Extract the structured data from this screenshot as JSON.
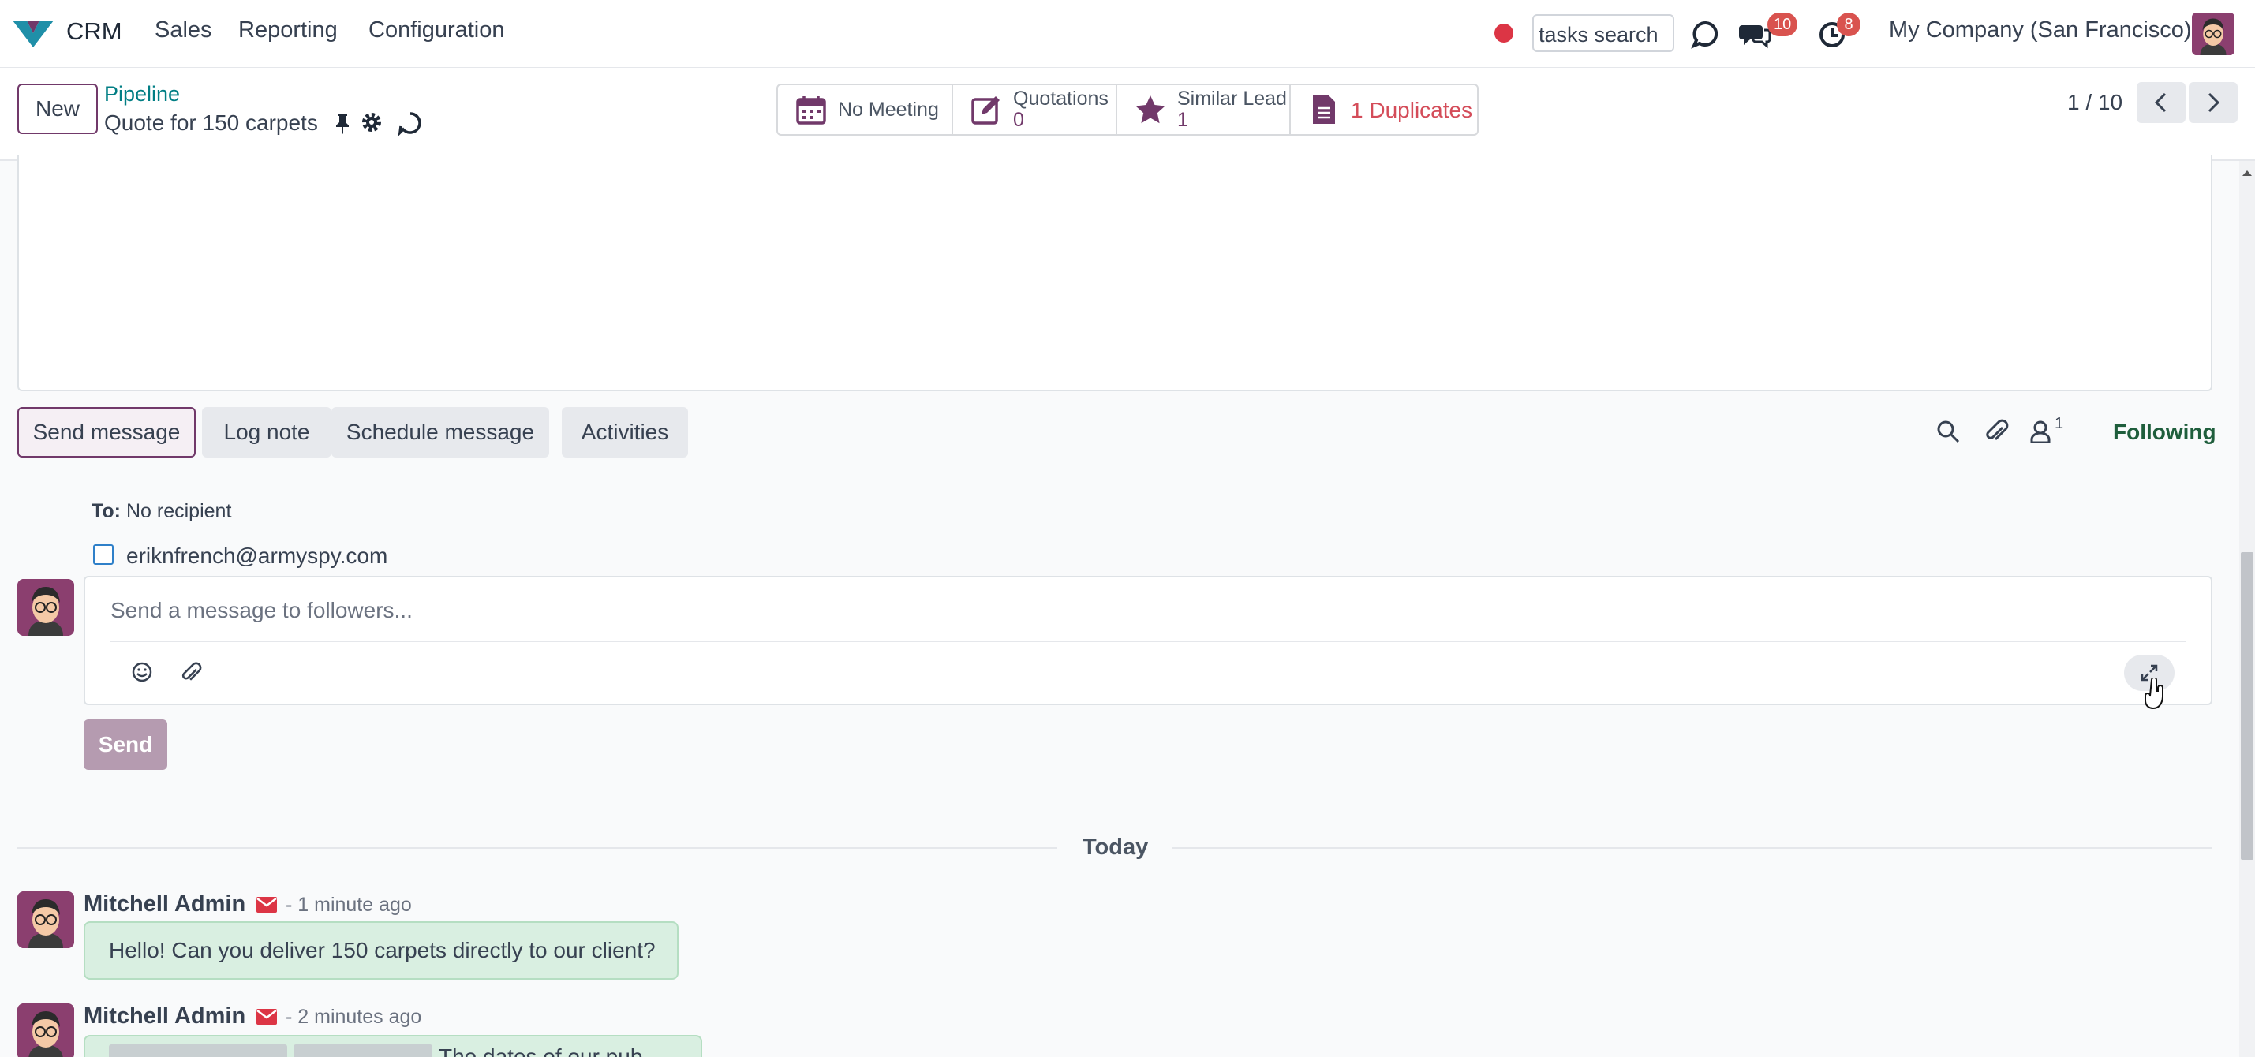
{
  "navbar": {
    "app_name": "CRM",
    "menu": [
      "Sales",
      "Reporting",
      "Configuration"
    ],
    "search_value": "tasks search",
    "messages_count": "10",
    "activities_count": "8",
    "company": "My Company (San Francisco)",
    "accent_color": "#71396a"
  },
  "control_panel": {
    "new_label": "New",
    "breadcrumb_parent": "Pipeline",
    "record_title": "Quote for 150 carpets",
    "pager": "1 / 10"
  },
  "smart_buttons": {
    "meeting": {
      "label": "No Meeting"
    },
    "quotations": {
      "label": "Quotations",
      "count": "0"
    },
    "similar": {
      "label": "Similar Lead",
      "count": "1"
    },
    "duplicates": {
      "label": "1 Duplicates"
    }
  },
  "chatter": {
    "tabs": [
      "Send message",
      "Log note",
      "Schedule message",
      "Activities"
    ],
    "followers_count": "1",
    "following_label": "Following",
    "to_label": "To:",
    "to_value": "No recipient",
    "suggested_recipient": "eriknfrench@armyspy.com",
    "composer_placeholder": "Send a message to followers...",
    "send_label": "Send",
    "date_separator": "Today",
    "messages": [
      {
        "author": "Mitchell Admin",
        "time": "- 1 minute ago",
        "body": "Hello! Can you deliver 150 carpets directly to our client?"
      },
      {
        "author": "Mitchell Admin",
        "time": "- 2 minutes ago",
        "body": "The dates of our pub..."
      }
    ]
  }
}
